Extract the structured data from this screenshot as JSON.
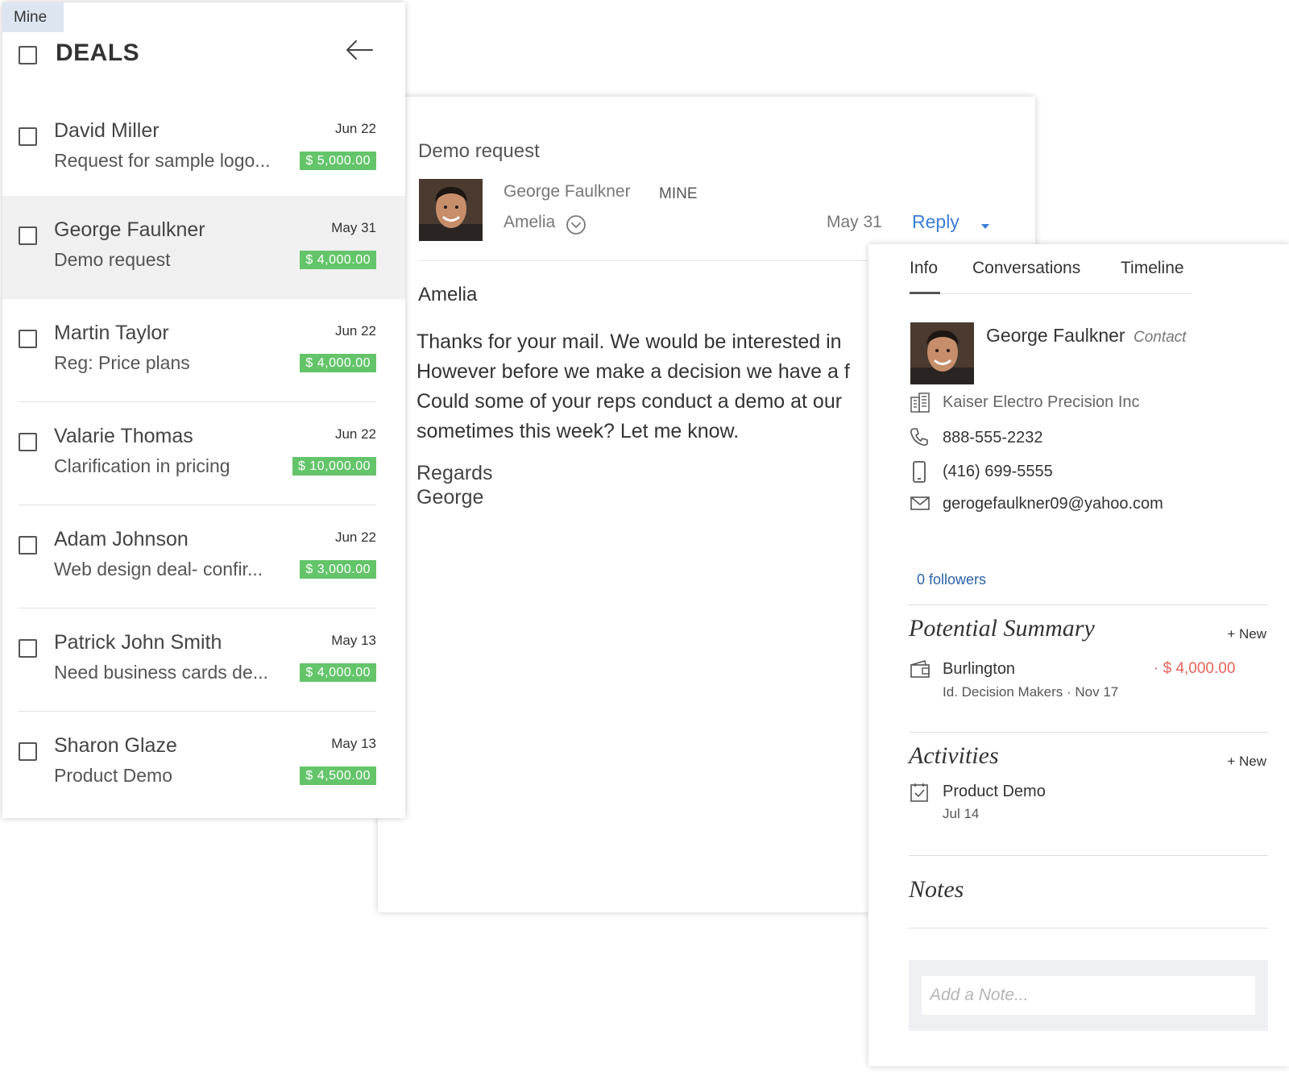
{
  "deals": {
    "filter_tag": "Mine",
    "title": "DEALS",
    "rows": [
      {
        "name": "David Miller",
        "subject": "Request for sample logo...",
        "date": "Jun 22",
        "amount": "$ 5,000.00"
      },
      {
        "name": "George Faulkner",
        "subject": "Demo request",
        "date": "May 31",
        "amount": "$ 4,000.00"
      },
      {
        "name": "Martin Taylor",
        "subject": "Reg: Price plans",
        "date": "Jun 22",
        "amount": "$ 4,000.00"
      },
      {
        "name": "Valarie Thomas",
        "subject": "Clarification in pricing",
        "date": "Jun 22",
        "amount": "$ 10,000.00"
      },
      {
        "name": "Adam Johnson",
        "subject": "Web design deal- confir...",
        "date": "Jun 22",
        "amount": "$ 3,000.00"
      },
      {
        "name": "Patrick John Smith",
        "subject": "Need business cards de...",
        "date": "May 13",
        "amount": "$ 4,000.00"
      },
      {
        "name": "Sharon Glaze",
        "subject": "Product Demo",
        "date": "May 13",
        "amount": "$ 4,500.00"
      }
    ]
  },
  "email": {
    "subject": "Demo request",
    "from": "George Faulkner",
    "tag": "MINE",
    "to": "Amelia",
    "date": "May 31",
    "reply_label": "Reply",
    "greeting": "Amelia",
    "body_lines": [
      "Thanks for your mail. We would be interested in",
      "However before we make a decision we have a f",
      "Could some of your reps conduct a demo at our",
      "sometimes this week? Let me know."
    ],
    "closing": "Regards",
    "signature": "George"
  },
  "info": {
    "tabs": [
      "Info",
      "Conversations",
      "Timeline"
    ],
    "contact": {
      "name": "George Faulkner",
      "type": "Contact",
      "company": "Kaiser Electro Precision Inc",
      "phone": "888-555-2232",
      "mobile": "(416) 699-5555",
      "email": "gerogefaulkner09@yahoo.com"
    },
    "followers": "0 followers",
    "potential_summary": {
      "title": "Potential Summary",
      "new_label": "+ New",
      "item": {
        "name": "Burlington",
        "details": "Id. Decision Makers · Nov 17",
        "amount": "· $ 4,000.00"
      }
    },
    "activities": {
      "title": "Activities",
      "new_label": "+ New",
      "item": {
        "name": "Product Demo",
        "date": "Jul 14"
      }
    },
    "notes": {
      "title": "Notes",
      "placeholder": "Add a Note..."
    }
  },
  "colors": {
    "amount_badge": "#64c46a",
    "reply_link": "#3b7ed6",
    "followers_link": "#2d62a8",
    "potential_amount": "#e4645a",
    "selected_row": "#f0f0f0"
  }
}
